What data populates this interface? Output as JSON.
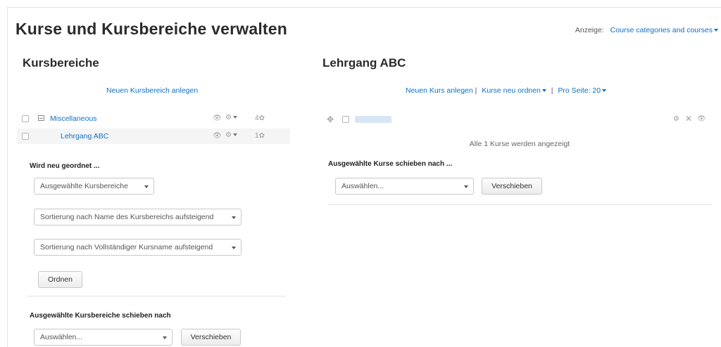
{
  "page": {
    "title": "Kurse und Kursbereiche verwalten",
    "view_label": "Anzeige:",
    "view_value": "Course categories and courses"
  },
  "left": {
    "heading": "Kursbereiche",
    "create_link": "Neuen Kursbereich anlegen",
    "categories": [
      {
        "name": "Miscellaneous",
        "count": "4"
      },
      {
        "name": "Lehrgang ABC",
        "count": "1"
      }
    ],
    "resort_heading": "Wird neu geordnet ...",
    "resort_scope": "Ausgewählte Kursbereiche",
    "sort_categories": "Sortierung nach Name des Kursbereichs aufsteigend",
    "sort_courses": "Sortierung nach Vollständiger Kursname aufsteigend",
    "resort_button": "Ordnen",
    "move_heading": "Ausgewählte Kursbereiche schieben nach",
    "move_select": "Auswählen...",
    "move_button": "Verschieben"
  },
  "right": {
    "heading": "Lehrgang ABC",
    "new_course_link": "Neuen Kurs anlegen",
    "resort_courses_link": "Kurse neu ordnen",
    "per_page_link": "Pro Seite: 20",
    "separator": "|",
    "course_name": " ",
    "showing_text": "Alle 1 Kurse werden angezeigt",
    "move_heading": "Ausgewählte Kurse schieben nach ...",
    "move_select": "Auswählen...",
    "move_button": "Verschieben"
  }
}
